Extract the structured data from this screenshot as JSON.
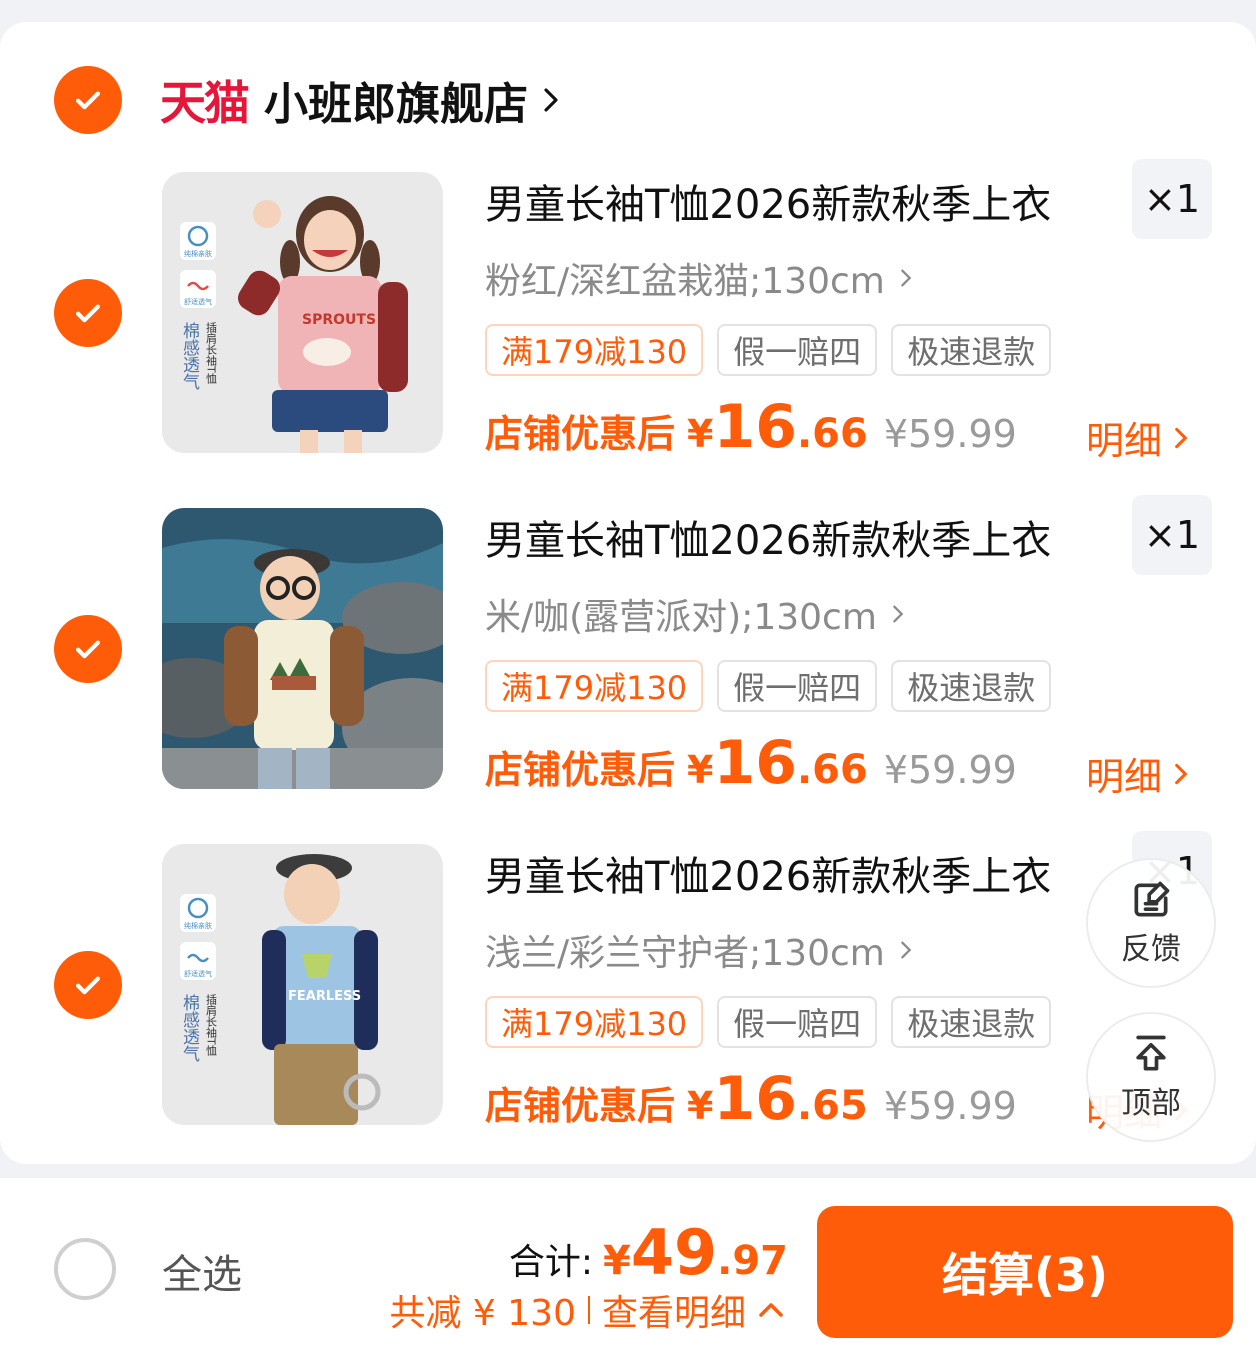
{
  "store": {
    "platform_logo": "天猫",
    "name": "小班郎旗舰店",
    "chevron_icon": "chevron-right-icon"
  },
  "products": [
    {
      "title": "男童长袖T恤2026新款秋季上衣",
      "quantity": "×1",
      "variant": "粉红/深红盆栽猫;130cm",
      "tags": [
        "满179减130",
        "假一赔四",
        "极速退款"
      ],
      "price_label": "店铺优惠后",
      "price_currency": "¥",
      "price_integer": "16",
      "price_decimal": ".66",
      "original_price": "¥59.99",
      "detail_label": "明细",
      "image_text": {
        "badge1": "纯棉亲肤",
        "badge2": "舒适透气",
        "vert1": "棉感透气",
        "vert2": "插肩长袖T恤",
        "shirt_print": "SPROUTS"
      }
    },
    {
      "title": "男童长袖T恤2026新款秋季上衣",
      "quantity": "×1",
      "variant": "米/咖(露营派对);130cm",
      "tags": [
        "满179减130",
        "假一赔四",
        "极速退款"
      ],
      "price_label": "店铺优惠后",
      "price_currency": "¥",
      "price_integer": "16",
      "price_decimal": ".66",
      "original_price": "¥59.99",
      "detail_label": "明细"
    },
    {
      "title": "男童长袖T恤2026新款秋季上衣",
      "quantity": "×1",
      "variant": "浅兰/彩兰守护者;130cm",
      "tags": [
        "满179减130",
        "假一赔四",
        "极速退款"
      ],
      "price_label": "店铺优惠后",
      "price_currency": "¥",
      "price_integer": "16",
      "price_decimal": ".65",
      "original_price": "¥59.99",
      "detail_label": "明细",
      "image_text": {
        "badge1": "纯棉亲肤",
        "badge2": "舒适透气",
        "vert1": "棉感透气",
        "vert2": "插肩长袖T恤",
        "shirt_print": "FEARLESS"
      }
    }
  ],
  "floating": {
    "feedback_label": "反馈",
    "top_label": "顶部"
  },
  "footer": {
    "select_all_label": "全选",
    "total_label": "合计:",
    "total_currency": "¥",
    "total_integer": "49",
    "total_decimal": ".97",
    "saving_text": "共减 ¥ 130",
    "view_detail": "查看明细",
    "checkout_label": "结算(3)"
  },
  "colors": {
    "accent": "#ff5c0a",
    "tmall_red": "#e5163a",
    "background": "#f1f2f5"
  }
}
